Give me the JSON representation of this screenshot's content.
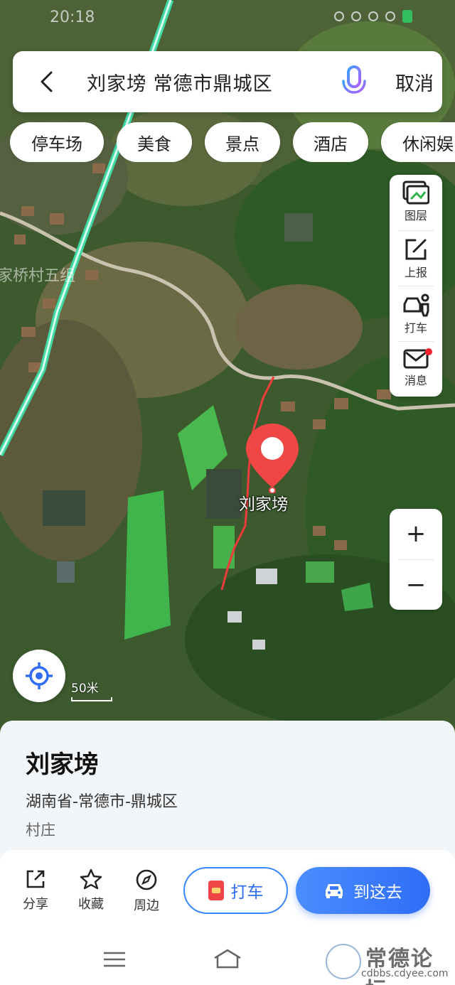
{
  "status_bar": {
    "time": "20:18"
  },
  "search": {
    "query": "刘家塝 常德市鼎城区",
    "cancel_label": "取消"
  },
  "chips": [
    "停车场",
    "美食",
    "景点",
    "酒店",
    "休闲娱"
  ],
  "tools": [
    {
      "name": "layers",
      "label": "图层",
      "icon": "layers-icon"
    },
    {
      "name": "report",
      "label": "上报",
      "icon": "edit-report-icon"
    },
    {
      "name": "taxi",
      "label": "打车",
      "icon": "taxi-person-icon"
    },
    {
      "name": "messages",
      "label": "消息",
      "icon": "mail-icon",
      "badge": true
    }
  ],
  "zoom": {
    "in": "+",
    "out": "−"
  },
  "map": {
    "pin_label": "刘家塝",
    "village_label": "家桥村五组",
    "scale_label": "50米",
    "route_color": "#f03b3b",
    "road_color": "#3fd9a4"
  },
  "place": {
    "name": "刘家塝",
    "address": "湖南省-常德市-鼎城区",
    "type": "村庄"
  },
  "actions": {
    "share": "分享",
    "favorite": "收藏",
    "nearby": "周边",
    "taxi": "打车",
    "go": "到这去"
  },
  "watermark": {
    "title": "常德论坛",
    "url": "cdbbs.cdyee.com"
  },
  "colors": {
    "accent": "#2f6df6",
    "pin": "#f04646"
  }
}
